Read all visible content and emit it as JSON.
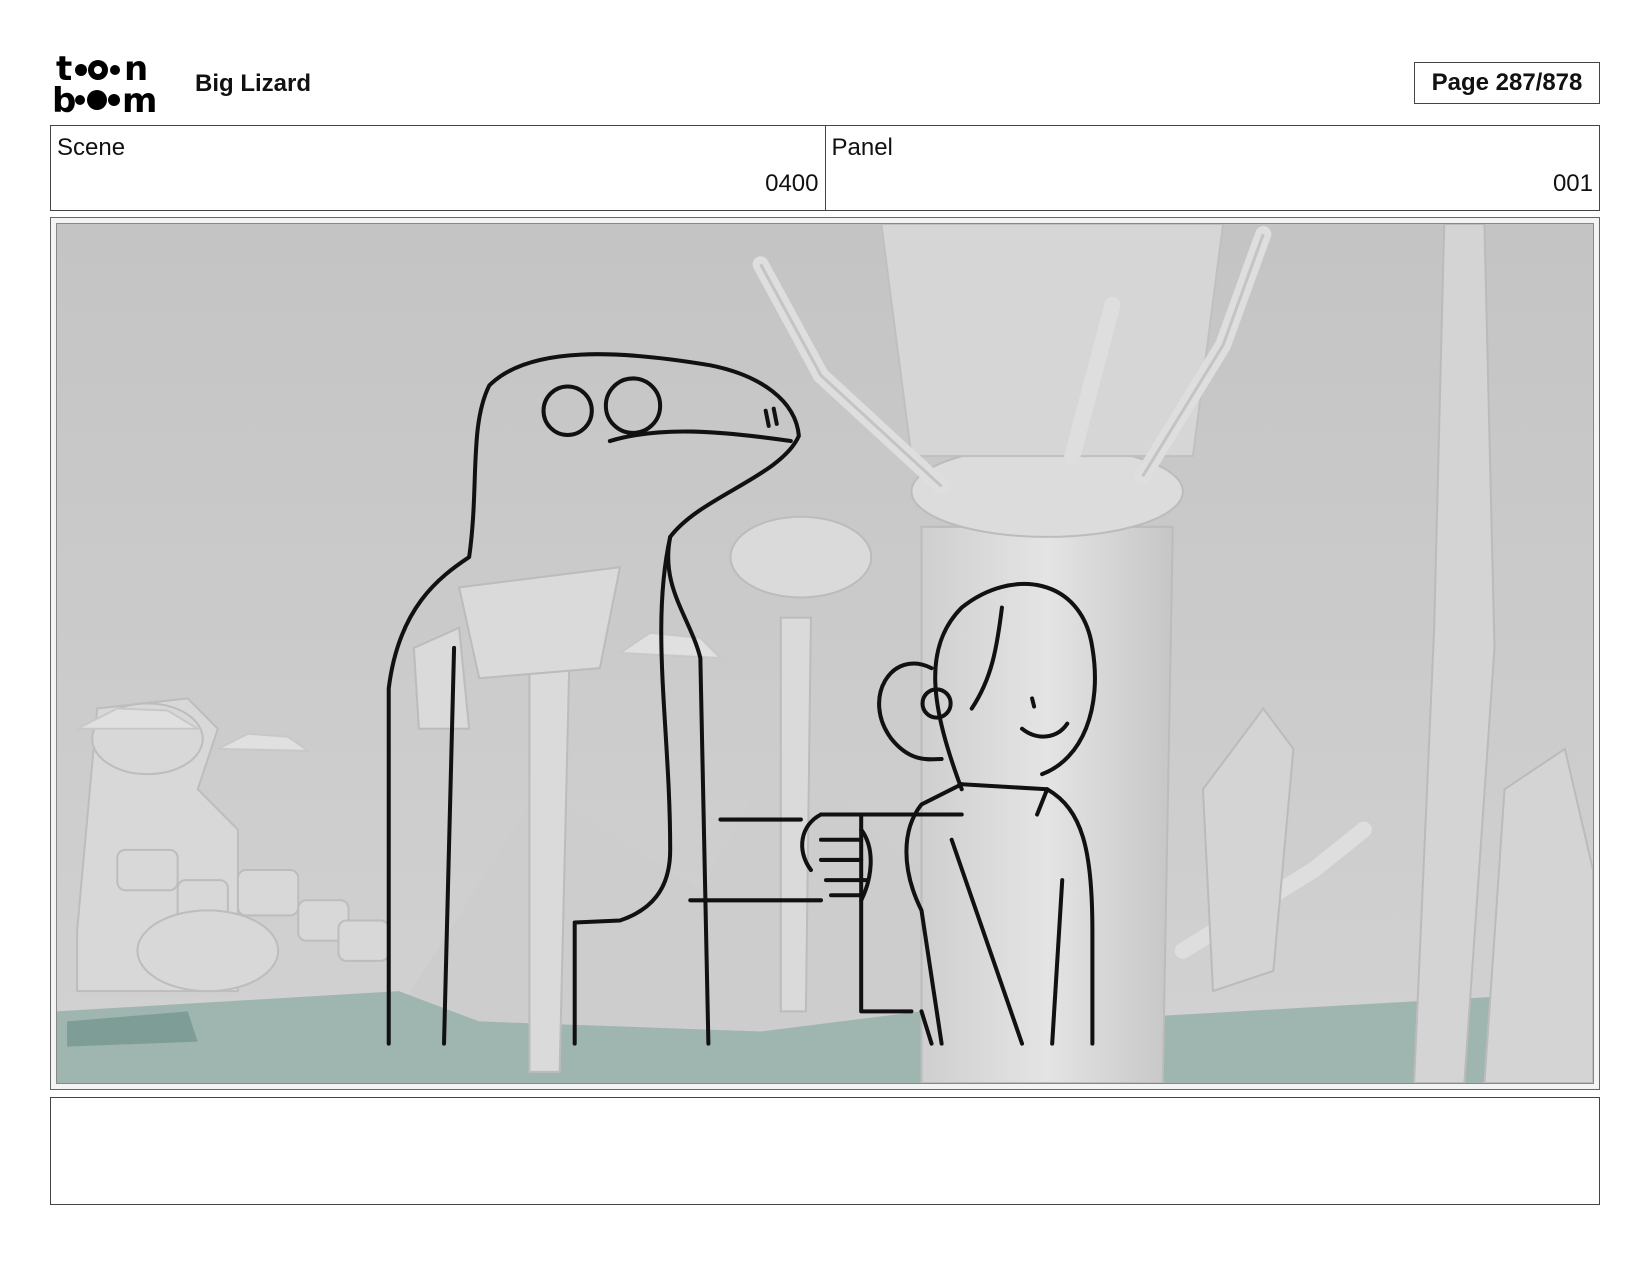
{
  "header": {
    "logo_text": "toonboom",
    "project_title": "Big Lizard",
    "page_label": "Page 287/878"
  },
  "scene": {
    "label": "Scene",
    "value": "0400"
  },
  "panel": {
    "label": "Panel",
    "value": "001"
  },
  "notes": {
    "text": ""
  }
}
